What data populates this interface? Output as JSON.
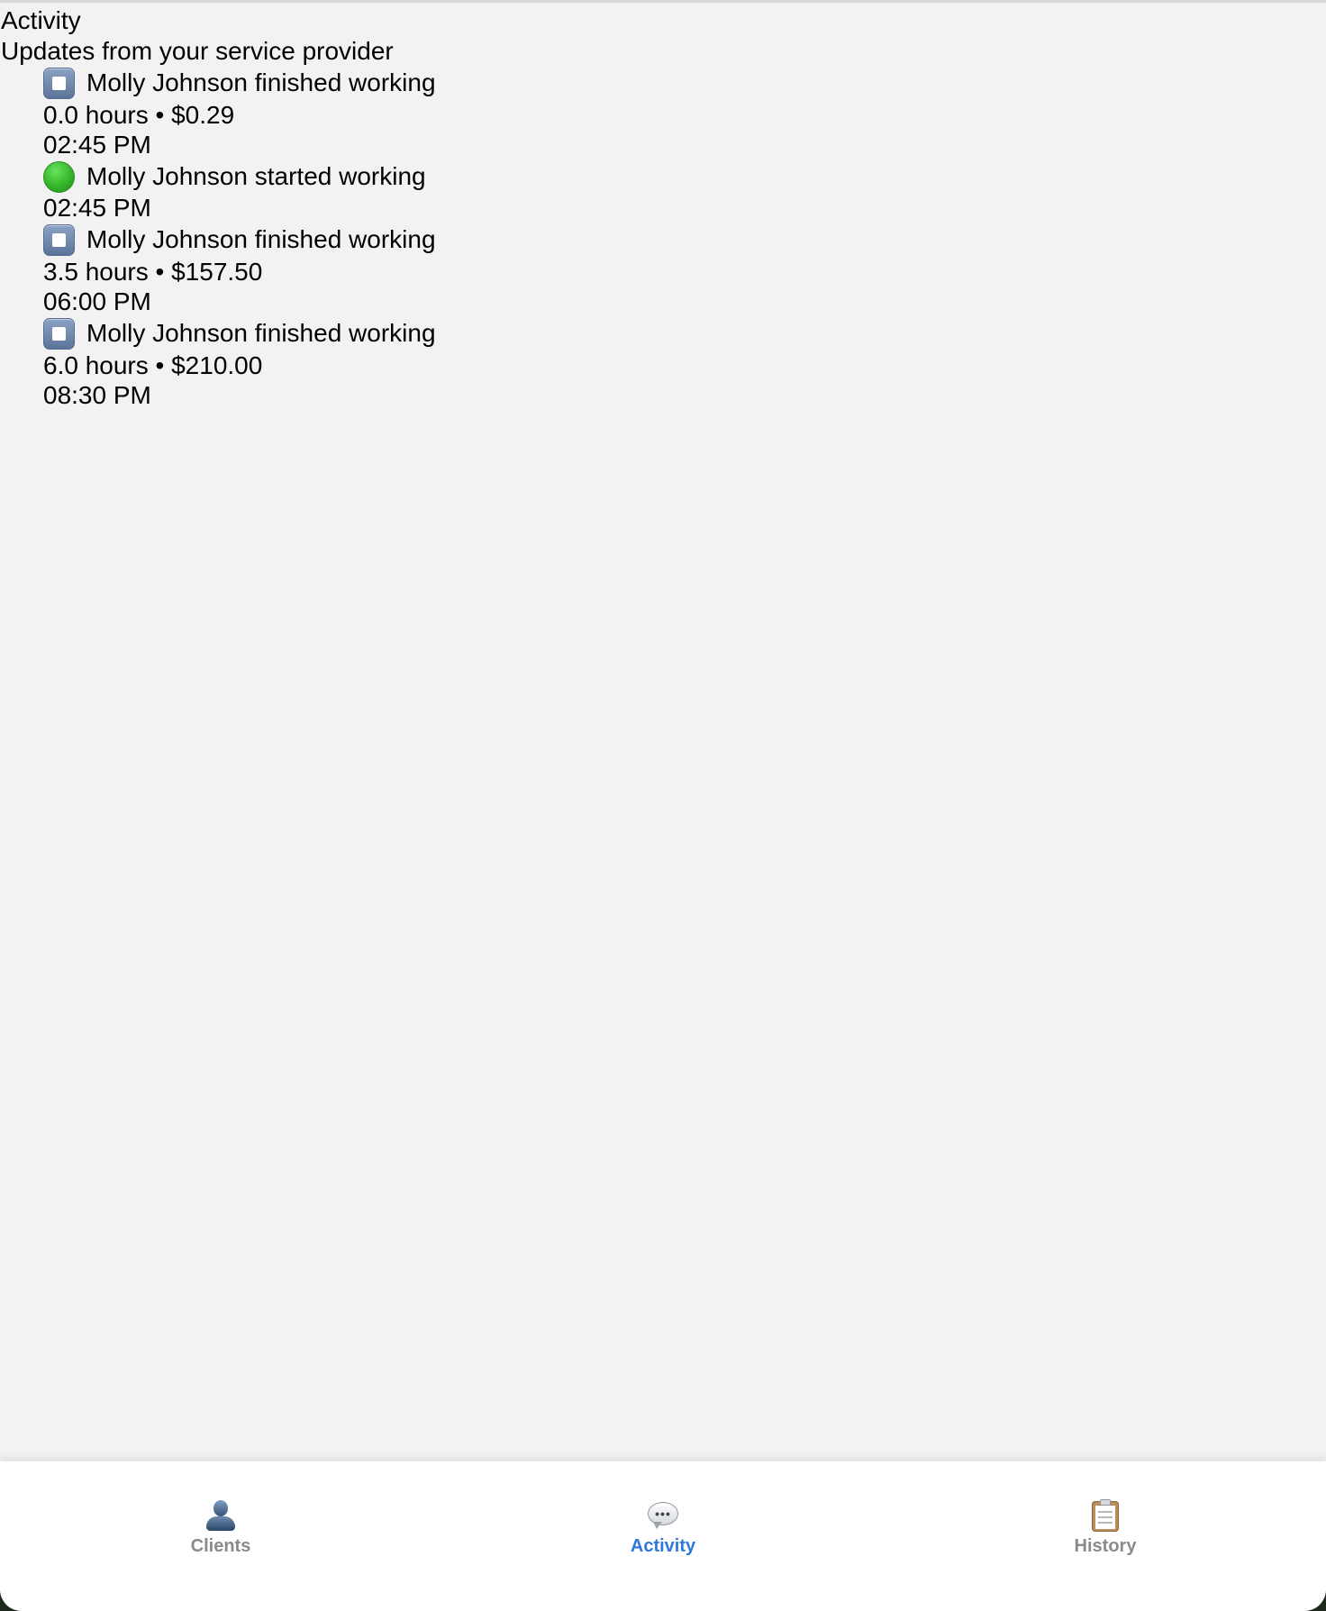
{
  "header": {
    "title": "Activity",
    "subtitle": "Updates from your service provider"
  },
  "activity": [
    {
      "icon": "stop-icon",
      "message": "Molly Johnson finished working",
      "meta": "0.0 hours • $0.29",
      "time": "02:45 PM"
    },
    {
      "icon": "green-circle-icon",
      "message": "Molly Johnson started working",
      "time": "02:45 PM"
    },
    {
      "icon": "stop-icon",
      "message": "Molly Johnson finished working",
      "meta": "3.5 hours • $157.50",
      "time": "06:00 PM"
    },
    {
      "icon": "stop-icon",
      "message": "Molly Johnson finished working",
      "meta": "6.0 hours • $210.00",
      "time": "08:30 PM"
    }
  ],
  "tabs": {
    "clients": "Clients",
    "activity": "Activity",
    "history": "History",
    "active": "activity",
    "active_color": "#2f78db",
    "inactive_color": "#8a8a8a"
  }
}
